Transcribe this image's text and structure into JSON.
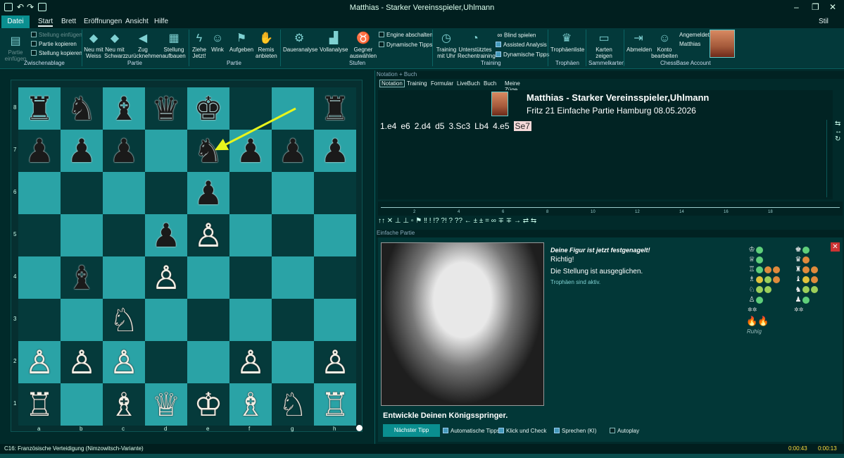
{
  "window": {
    "title": "Matthias - Starker Vereinsspieler,Uhlmann",
    "stil_label": "Stil"
  },
  "menu": {
    "items": [
      "Datei",
      "Start",
      "Brett",
      "Eröffnungen",
      "Ansicht",
      "Hilfe"
    ],
    "active": "Start"
  },
  "ribbon": {
    "groups": [
      "Zwischenablage",
      "Partie",
      "Partie",
      "Stufen",
      "Training",
      "Trophäen",
      "Sammelkarten",
      "ChessBase Account"
    ],
    "partie_einfuegen": "Partie einfügen",
    "stellung_einfuegen": "Stellung einfügen",
    "partie_kopieren": "Partie kopieren",
    "stellung_kopieren": "Stellung kopieren",
    "neu_weiss": "Neu mit Weiss",
    "neu_schwarz": "Neu mit Schwarz",
    "zug_zurueck": "Zug zurücknehmen",
    "stellung_aufbauen": "Stellung aufbauen",
    "ziehe_jetzt": "Ziehe Jetzt!",
    "wink": "Wink",
    "aufgeben": "Aufgeben",
    "remis": "Remis anbieten",
    "engine_abschalten": "Engine abschalten",
    "dynamische_tipps": "Dynamische Tipps",
    "daueranalyse": "Daueranalyse",
    "vollanalyse": "Vollanalyse",
    "gegner": "Gegner auswählen",
    "training_uhr": "Training mit Uhr",
    "unterstuetztes": "Unterstütztes Rechentraining",
    "blind": "Blind spielen",
    "assisted": "Assisted Analysis",
    "dyn_tipps2": "Dynamische Tipps",
    "trophaeenliste": "Trophäenliste",
    "karten": "Karten zeigen",
    "abmelden": "Abmelden",
    "konto": "Konto bearbeiten",
    "angemeldet": "Angemeldet",
    "user": "Matthias"
  },
  "board": {
    "files": [
      "a",
      "b",
      "c",
      "d",
      "e",
      "f",
      "g",
      "h"
    ],
    "ranks": [
      "8",
      "7",
      "6",
      "5",
      "4",
      "3",
      "2",
      "1"
    ],
    "pieces": [
      [
        "♜",
        "♞",
        "♝",
        "♛",
        "♚",
        "",
        "",
        "♜"
      ],
      [
        "♟",
        "♟",
        "♟",
        "",
        "♞",
        "♟",
        "♟",
        "♟"
      ],
      [
        "",
        "",
        "",
        "",
        "♟",
        "",
        "",
        ""
      ],
      [
        "",
        "",
        "",
        "♟",
        "♙",
        "",
        "",
        ""
      ],
      [
        "",
        "♝",
        "",
        "♙",
        "",
        "",
        "",
        ""
      ],
      [
        "",
        "",
        "♘",
        "",
        "",
        "",
        "",
        ""
      ],
      [
        "♙",
        "♙",
        "♙",
        "",
        "",
        "♙",
        "",
        "♙"
      ],
      [
        "♖",
        "",
        "♗",
        "♕",
        "♔",
        "♗",
        "♘",
        "♖"
      ]
    ],
    "colors": [
      [
        "b",
        "b",
        "b",
        "b",
        "b",
        "",
        "",
        "b"
      ],
      [
        "b",
        "b",
        "b",
        "",
        "b",
        "b",
        "b",
        "b"
      ],
      [
        "",
        "",
        "",
        "",
        "b",
        "",
        "",
        ""
      ],
      [
        "",
        "",
        "",
        "b",
        "w",
        "",
        "",
        ""
      ],
      [
        "",
        "b",
        "",
        "w",
        "",
        "",
        "",
        ""
      ],
      [
        "",
        "",
        "w",
        "",
        "",
        "",
        "",
        ""
      ],
      [
        "w",
        "w",
        "w",
        "",
        "",
        "w",
        "",
        "w"
      ],
      [
        "w",
        "",
        "w",
        "w",
        "w",
        "w",
        "w",
        "w"
      ]
    ],
    "arrow_color": "#e7f51c"
  },
  "notation": {
    "header": "Notation + Buch",
    "tabs": [
      "Notation",
      "Training",
      "Formular",
      "LiveBuch",
      "Buch",
      "Meine Züge"
    ],
    "active_tab": "Notation",
    "game_title": "Matthias - Starker Vereinsspieler,Uhlmann",
    "game_sub": "Fritz 21 Einfache Partie Hamburg 08.05.2026",
    "moves": [
      "1.e4",
      "e6",
      "2.d4",
      "d5",
      "3.Sc3",
      "Lb4",
      "4.e5",
      "Se7"
    ],
    "current_move_index": 7
  },
  "timeline": {
    "ticks": [
      "2",
      "4",
      "6",
      "8",
      "10",
      "12",
      "14",
      "16",
      "18"
    ]
  },
  "annotations": "↑↑ ✕ ⊥ ⊥ ▫ ⚑ ‼ ! !? ?! ? ?? ← ± ± = ∞ ∓ ∓ → ⇄ ⇆",
  "coach": {
    "header": "Einfache Partie",
    "msg1": "Deine Figur ist jetzt festgenagelt!",
    "msg2": "Richtig!",
    "msg3": "Die Stellung ist ausgeglichen.",
    "msg4": "Trophäen sind aktiv.",
    "ruhig": "Ruhig",
    "tip": "Entwickle Deinen Königsspringer.",
    "next_tip": "Nächster Tipp",
    "options": [
      {
        "label": "Automatische Tipps",
        "checked": true
      },
      {
        "label": "Klick und Check",
        "checked": true
      },
      {
        "label": "Sprechen (KI)",
        "checked": true
      },
      {
        "label": "Autoplay",
        "checked": false
      }
    ]
  },
  "status": {
    "opening": "C16: Französische Verteidigung (Nimzowitsch-Variante)",
    "clock1": "0:00:43",
    "clock2": "0:00:13"
  },
  "colors": {
    "accent": "#0a8f90",
    "light_square": "#2aa3a6",
    "dark_square": "#053a3b"
  }
}
